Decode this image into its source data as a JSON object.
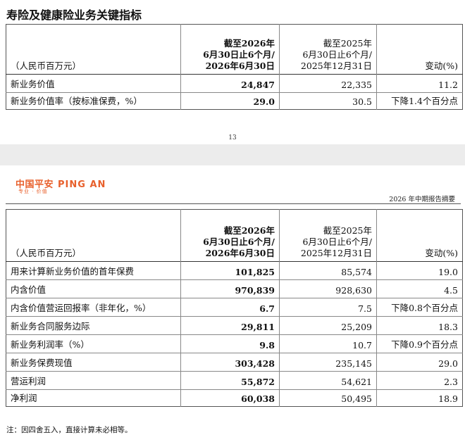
{
  "section_title": "寿险及健康险业务关键指标",
  "table_headers": {
    "unit": "（人民币百万元）",
    "col1": [
      "截至2026年",
      "6月30日止6个月/",
      "2026年6月30日"
    ],
    "col2": [
      "截至2025年",
      "6月30日止6个月/",
      "2025年12月31日"
    ],
    "col3": "变动(%)"
  },
  "table1": [
    {
      "label": "新业务价值",
      "v2026": "24,847",
      "v2025": "22,335",
      "change": "11.2"
    },
    {
      "label": "新业务价值率（按标准保费，%）",
      "v2026": "29.0",
      "v2025": "30.5",
      "change": "下降1.4个百分点"
    }
  ],
  "page_number": "13",
  "header": {
    "logo_cn": "中国平安",
    "logo_en": "PING AN",
    "slogan": "专业 · 价值",
    "report_name": "2026 年中期报告摘要"
  },
  "table2": [
    {
      "label": "用来计算新业务价值的首年保费",
      "v2026": "101,825",
      "v2025": "85,574",
      "change": "19.0"
    },
    {
      "label": "内含价值",
      "v2026": "970,839",
      "v2025": "928,630",
      "change": "4.5"
    },
    {
      "label": "内含价值营运回报率（非年化，%）",
      "v2026": "6.7",
      "v2025": "7.5",
      "change": "下降0.8个百分点"
    },
    {
      "label": "新业务合同服务边际",
      "v2026": "29,811",
      "v2025": "25,209",
      "change": "18.3"
    },
    {
      "label": "新业务利润率（%）",
      "v2026": "9.8",
      "v2025": "10.7",
      "change": "下降0.9个百分点"
    },
    {
      "label": "新业务保费现值",
      "v2026": "303,428",
      "v2025": "235,145",
      "change": "29.0"
    },
    {
      "label": "营运利润",
      "v2026": "55,872",
      "v2025": "54,621",
      "change": "2.3"
    },
    {
      "label": "净利润",
      "v2026": "60,038",
      "v2025": "50,495",
      "change": "18.9"
    }
  ],
  "footnote": "注：因四舍五入，直接计算未必相等。",
  "colors": {
    "brand": "#e8602c",
    "gap": "#ececec"
  }
}
